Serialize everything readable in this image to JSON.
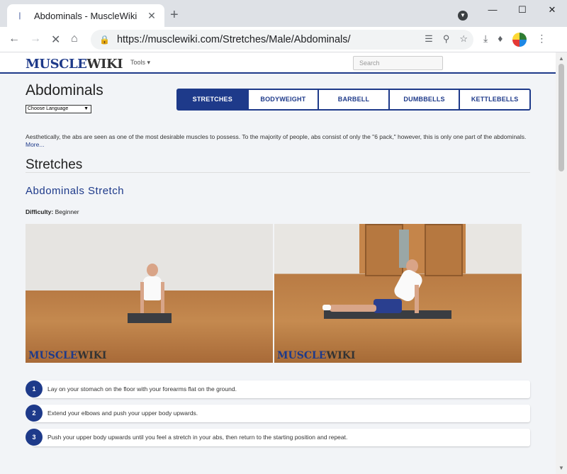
{
  "browser": {
    "tab_title": "Abdominals - MuscleWiki",
    "url": "https://musclewiki.com/Stretches/Male/Abdominals/"
  },
  "site": {
    "logo_muscle": "MUSCLE",
    "logo_wiki": "WIKI",
    "tools_label": "Tools",
    "search_placeholder": "Search"
  },
  "page": {
    "title": "Abdominals",
    "language_select": "Choose Language",
    "categories": [
      {
        "label": "STRETCHES",
        "active": true
      },
      {
        "label": "BODYWEIGHT",
        "active": false
      },
      {
        "label": "BARBELL",
        "active": false
      },
      {
        "label": "DUMBBELLS",
        "active": false
      },
      {
        "label": "KETTLEBELLS",
        "active": false
      }
    ],
    "description": "Aesthetically, the abs are seen as one of the most desirable muscles to possess. To the majority of people, abs consist of only the \"6 pack,\" however, this is only one part of the abdominals.",
    "more_link": "More...",
    "section_heading": "Stretches"
  },
  "exercise": {
    "title": "Abdominals Stretch",
    "difficulty_label": "Difficulty:",
    "difficulty_value": "Beginner",
    "steps": [
      {
        "num": "1",
        "text": "Lay on your stomach on the floor with your forearms flat on the ground."
      },
      {
        "num": "2",
        "text": "Extend your elbows and push your upper body upwards."
      },
      {
        "num": "3",
        "text": "Push your upper body upwards until you feel a stretch in your abs, then return to the starting position and repeat."
      }
    ]
  },
  "icons": {
    "back": "arrow-left-icon",
    "forward": "arrow-right-icon",
    "reload": "stop-icon",
    "home": "home-icon"
  }
}
